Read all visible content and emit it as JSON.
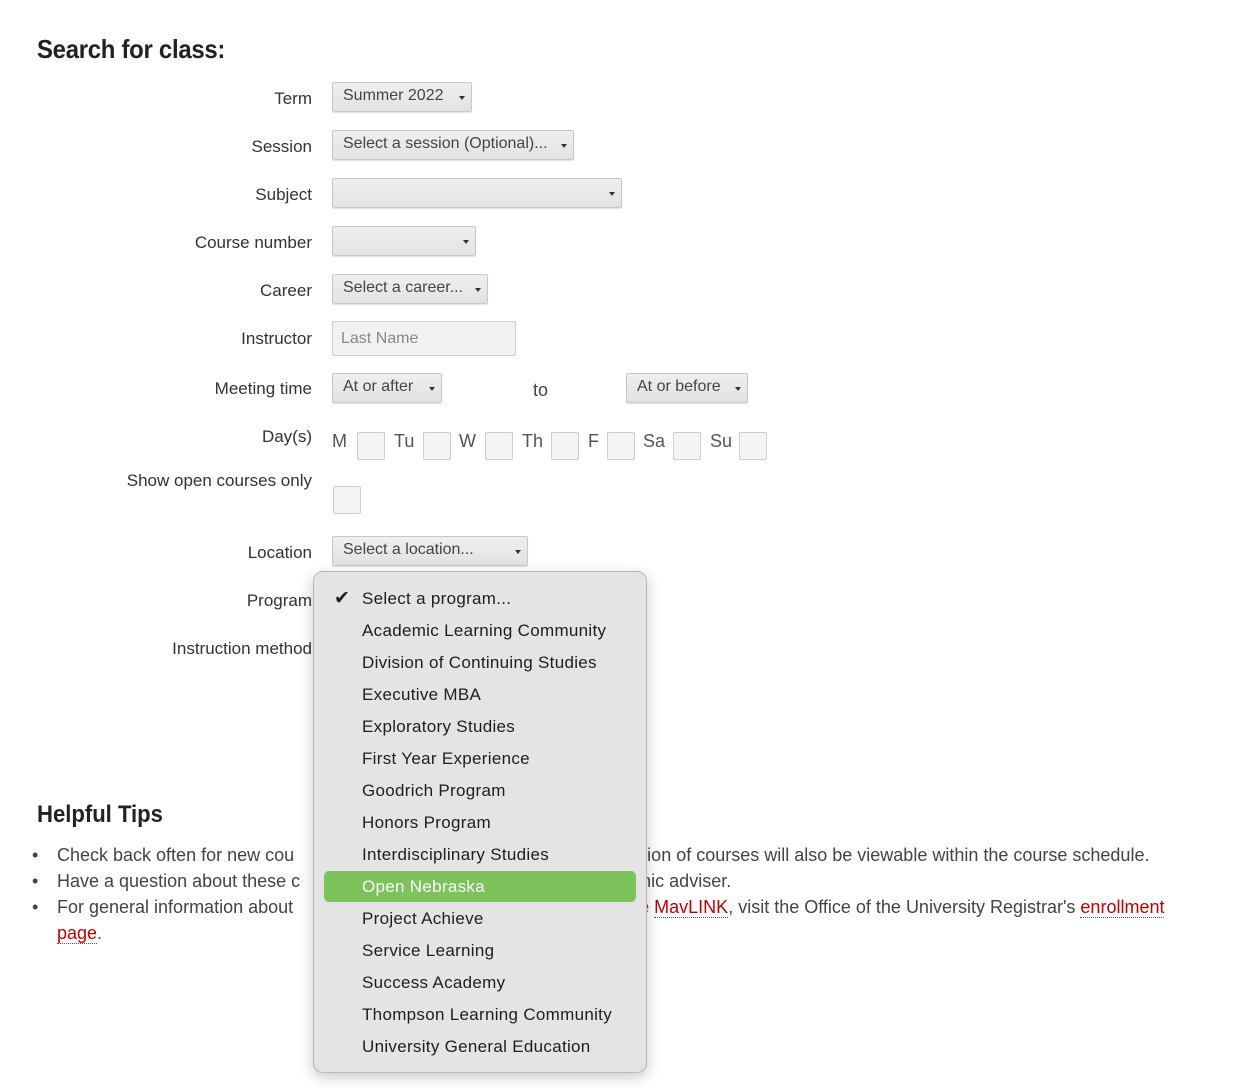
{
  "page": {
    "title": "Search for class:"
  },
  "form": {
    "term": {
      "label": "Term",
      "value": "Summer 2022"
    },
    "session": {
      "label": "Session",
      "value": "Select a session (Optional)..."
    },
    "subject": {
      "label": "Subject",
      "value": ""
    },
    "course_number": {
      "label": "Course number",
      "value": ""
    },
    "career": {
      "label": "Career",
      "value": "Select a career..."
    },
    "instructor": {
      "label": "Instructor",
      "placeholder": "Last Name",
      "value": ""
    },
    "meeting_time": {
      "label": "Meeting time",
      "from": "At or after",
      "to_label": "to",
      "to": "At or before"
    },
    "days": {
      "label": "Day(s)",
      "items": [
        {
          "label": "M",
          "checked": false
        },
        {
          "label": "Tu",
          "checked": false
        },
        {
          "label": "W",
          "checked": false
        },
        {
          "label": "Th",
          "checked": false
        },
        {
          "label": "F",
          "checked": false
        },
        {
          "label": "Sa",
          "checked": false
        },
        {
          "label": "Su",
          "checked": false
        }
      ]
    },
    "open_only": {
      "label": "Show open courses only",
      "checked": false
    },
    "location": {
      "label": "Location",
      "value": "Select a location..."
    },
    "program": {
      "label": "Program"
    },
    "instruction_method": {
      "label": "Instruction method"
    }
  },
  "program_dropdown": {
    "selected_index": 0,
    "highlighted_index": 9,
    "options": [
      "Select a program...",
      "Academic Learning Community",
      "Division of Continuing Studies",
      "Executive MBA",
      "Exploratory Studies",
      "First Year Experience",
      "Goodrich Program",
      "Honors Program",
      "Interdisciplinary Studies",
      "Open Nebraska",
      "Project Achieve",
      "Service Learning",
      "Success Academy",
      "Thompson Learning Community",
      "University General Education"
    ],
    "check_icon": "checkmark-icon",
    "highlight_color": "#7bc35a"
  },
  "tips": {
    "title": "Helpful Tips",
    "item1_a": "Check back often for new cou",
    "item1_b": "nd location of courses will also be viewable within the course schedule.",
    "item2_a": "Have a question about these c",
    "item2_b": "lemic adviser.",
    "item3_a": "For general information about",
    "item3_b": "se ",
    "item3_link1": "MavLINK",
    "item3_c": ", visit the Office of the University Registrar's ",
    "item3_link2": "enrollment page",
    "item3_d": ".",
    "link_color": "#c00000"
  }
}
